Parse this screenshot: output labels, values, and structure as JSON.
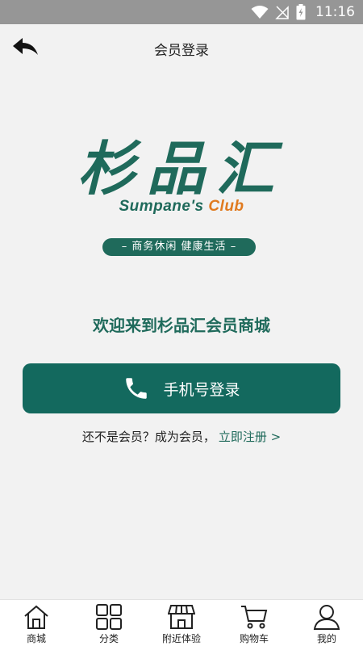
{
  "status_bar": {
    "time": "11:16"
  },
  "header": {
    "title": "会员登录"
  },
  "logo": {
    "name_cn": "杉品汇",
    "name_en_main": "Sumpane's",
    "name_en_club": "Club",
    "slogan": "– 商务休闲  健康生活 –"
  },
  "welcome_text": "欢迎来到杉品汇会员商城",
  "login_button": {
    "label": "手机号登录"
  },
  "register": {
    "prompt": "还不是会员？成为会员，",
    "link": "立即注册 >"
  },
  "tabbar": {
    "items": [
      {
        "label": "商城",
        "icon": "home-icon"
      },
      {
        "label": "分类",
        "icon": "grid-icon"
      },
      {
        "label": "附近体验",
        "icon": "store-icon"
      },
      {
        "label": "购物车",
        "icon": "cart-icon"
      },
      {
        "label": "我的",
        "icon": "user-icon"
      }
    ]
  },
  "colors": {
    "brand": "#13695e",
    "accent": "#e07a1f",
    "status_bar": "#969696"
  }
}
